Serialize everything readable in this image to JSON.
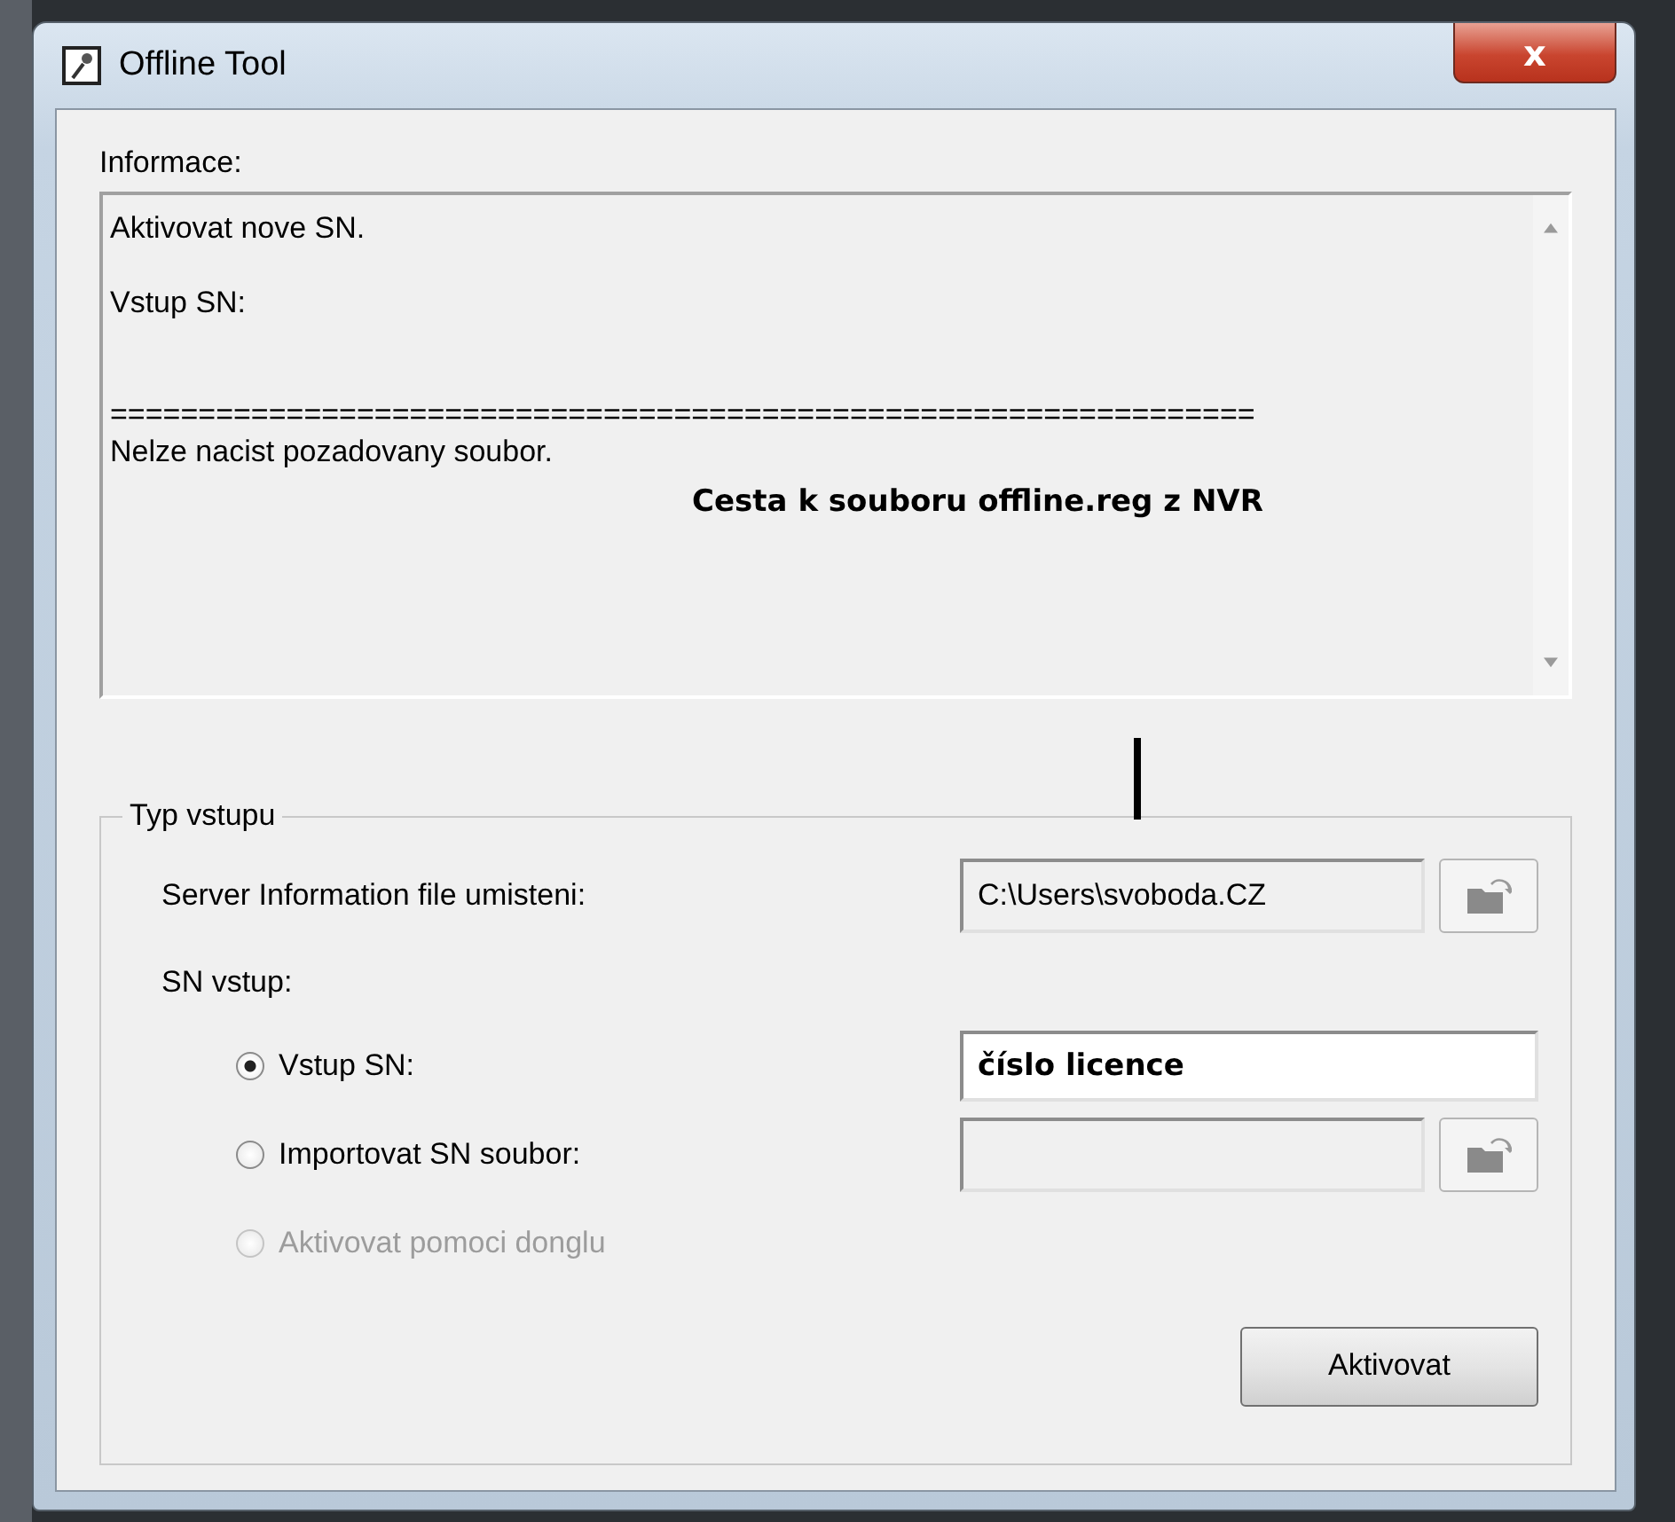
{
  "window": {
    "title": "Offline Tool",
    "close_glyph": "x"
  },
  "info": {
    "label": "Informace:",
    "lines": [
      {
        "text": "Aktivovat nove SN.",
        "kind": "text"
      },
      {
        "kind": "blank"
      },
      {
        "text": "Vstup SN:",
        "kind": "text"
      },
      {
        "kind": "blank"
      },
      {
        "kind": "blank"
      },
      {
        "text": "=================================================================",
        "kind": "text"
      },
      {
        "text": "Nelze nacist pozadovany soubor.",
        "kind": "text"
      }
    ],
    "annotation": "Cesta k souboru offline.reg z NVR"
  },
  "input_group": {
    "title": "Typ vstupu",
    "server_file": {
      "label": "Server Information file umisteni:",
      "value": "C:\\Users\\svoboda.CZ"
    },
    "sn_label": "SN vstup:",
    "options": [
      {
        "label": "Vstup SN:",
        "selected": true,
        "disabled": false,
        "kind": "text",
        "value": "číslo licence"
      },
      {
        "label": "Importovat SN soubor:",
        "selected": false,
        "disabled": false,
        "kind": "file"
      },
      {
        "label": "Aktivovat pomoci donglu",
        "selected": false,
        "disabled": true,
        "kind": "none"
      }
    ]
  },
  "buttons": [
    "Aktivovat"
  ]
}
